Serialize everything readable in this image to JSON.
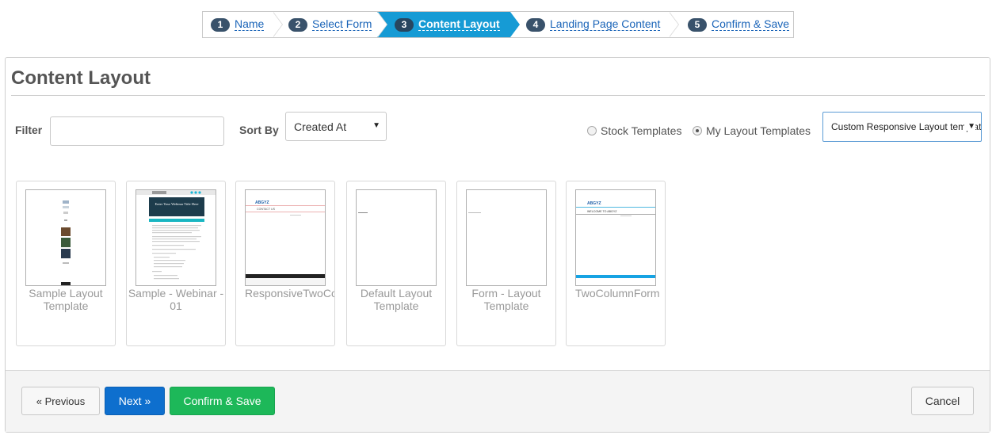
{
  "wizard": {
    "steps": [
      {
        "num": "1",
        "label": "Name"
      },
      {
        "num": "2",
        "label": "Select Form"
      },
      {
        "num": "3",
        "label": "Content Layout"
      },
      {
        "num": "4",
        "label": "Landing Page Content"
      },
      {
        "num": "5",
        "label": "Confirm & Save"
      }
    ]
  },
  "page": {
    "title": "Content Layout"
  },
  "filters": {
    "filter_label": "Filter",
    "filter_value": "",
    "sort_label": "Sort By",
    "sort_value": "Created At",
    "radio_stock": "Stock Templates",
    "radio_my": "My Layout Templates",
    "selected_radio": "My Layout Templates",
    "template_select_value": "Custom Responsive Layout templates"
  },
  "templates": [
    {
      "label": "Sample Layout Template"
    },
    {
      "label": "Sample - Webinar - 01",
      "thumb_heading": "Enter Your Webinar Title Here"
    },
    {
      "label": "ResponsiveTwoColumn",
      "thumb_logo": "ABGYZ",
      "thumb_heading": "CONTACT US"
    },
    {
      "label": "Default Layout Template"
    },
    {
      "label": "Form - Layout Template"
    },
    {
      "label": "TwoColumnForm",
      "thumb_logo": "ABGYZ",
      "thumb_heading": "WELCOME TO ABGYZ"
    }
  ],
  "footer": {
    "previous": "« Previous",
    "next": "Next »",
    "confirm": "Confirm & Save",
    "cancel": "Cancel"
  },
  "colors": {
    "active_step": "#169bd5",
    "next_button": "#0e6fce",
    "confirm_button": "#1db859"
  }
}
